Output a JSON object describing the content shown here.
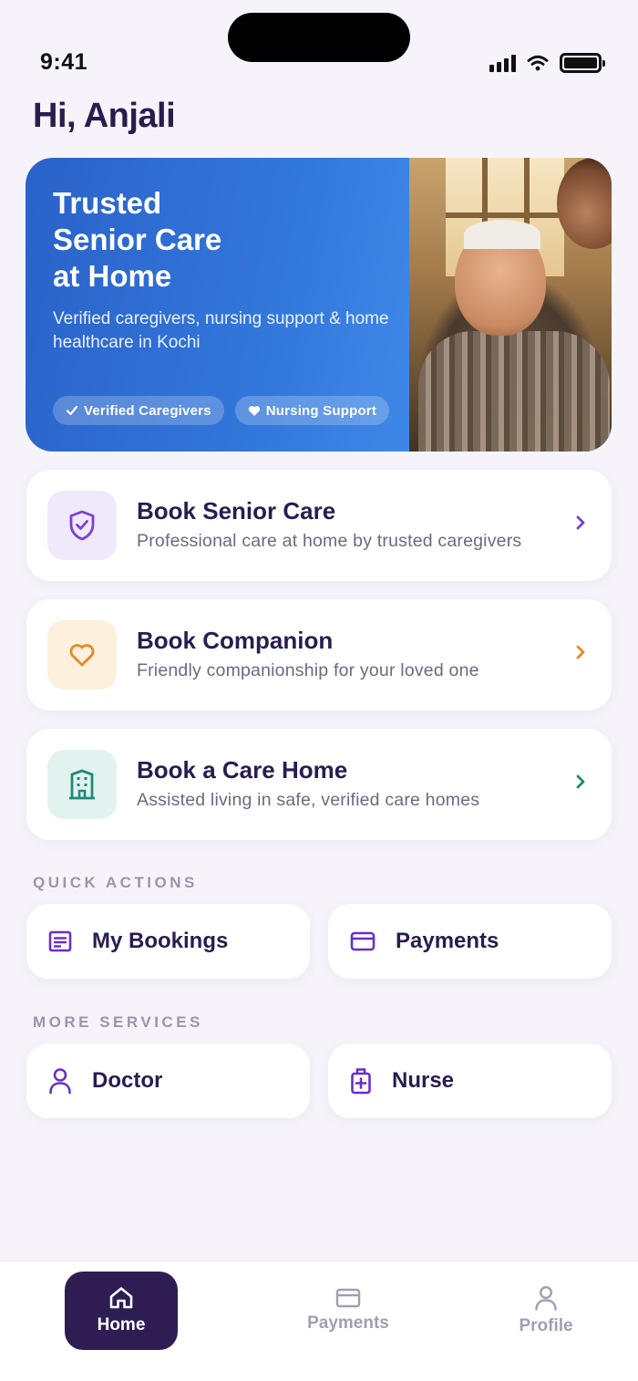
{
  "status_bar": {
    "time": "9:41"
  },
  "greeting": "Hi, Anjali",
  "hero": {
    "title_line1": "Trusted",
    "title_line2": "Senior Care",
    "title_line3": "at Home",
    "subtitle": "Verified caregivers, nursing support & home healthcare in Kochi",
    "chips": [
      "Verified Caregivers",
      "Nursing Support"
    ]
  },
  "services": [
    {
      "title": "Book Senior Care",
      "description": "Professional care at home by trusted caregivers",
      "icon": "shield-check-icon",
      "color": "#7b3fd6",
      "bg": "#efe9fb"
    },
    {
      "title": "Book Companion",
      "description": "Friendly companionship for your loved one",
      "icon": "heart-icon",
      "color": "#e08a2a",
      "bg": "#fdf0dc"
    },
    {
      "title": "Book a Care Home",
      "description": "Assisted living in safe, verified care homes",
      "icon": "building-icon",
      "color": "#1f8a78",
      "bg": "#e2f3ef"
    }
  ],
  "quick_actions": {
    "label": "QUICK ACTIONS",
    "items": [
      {
        "label": "My Bookings",
        "icon": "list-icon"
      },
      {
        "label": "Payments",
        "icon": "card-icon"
      }
    ]
  },
  "more_services": {
    "label": "MORE SERVICES",
    "items": [
      {
        "label": "Doctor",
        "icon": "person-icon"
      },
      {
        "label": "Nurse",
        "icon": "medical-kit-icon"
      }
    ]
  },
  "bottom_nav": [
    {
      "label": "Home",
      "icon": "home-icon",
      "active": true
    },
    {
      "label": "Payments",
      "icon": "card-icon",
      "active": false
    },
    {
      "label": "Profile",
      "icon": "person-icon",
      "active": false
    }
  ],
  "colors": {
    "primary": "#2e1d52",
    "accent_purple": "#7b3fd6",
    "hero_blue": "#3378dc"
  }
}
